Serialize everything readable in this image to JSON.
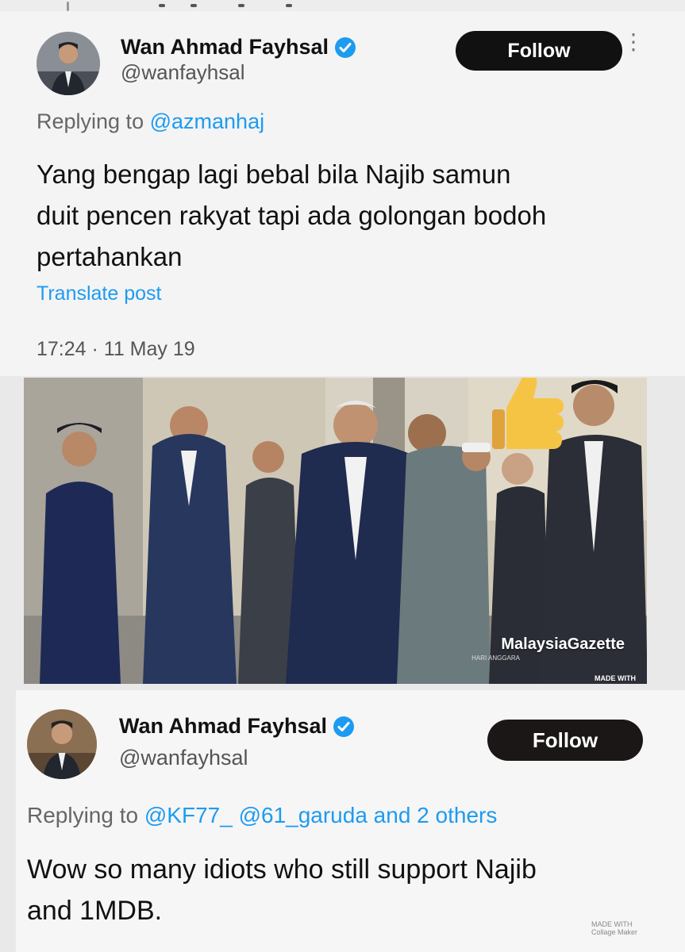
{
  "tweet1": {
    "display_name": "Wan Ahmad Fayhsal",
    "handle": "@wanfayhsal",
    "follow_label": "Follow",
    "replying_prefix": "Replying to",
    "replying_to": "@azmanhaj",
    "text_lines": [
      "Yang bengap lagi bebal bila Najib samun",
      "duit pencen rakyat tapi ada golongan bodoh",
      "pertahankan"
    ],
    "translate_label": "Translate post",
    "timestamp": "17:24 · 11 May 19"
  },
  "photo": {
    "watermark": "MalaysiaGazette",
    "watermark_credit": "HARI ANGGARA",
    "made_with": "MADE WITH",
    "emoji": "thumbs-up"
  },
  "tweet2": {
    "display_name": "Wan Ahmad Fayhsal",
    "handle": "@wanfayhsal",
    "follow_label": "Follow",
    "replying_prefix": "Replying to",
    "replying_to": "@KF77_ @61_garuda and 2 others",
    "text_lines": [
      "Wow so many idiots who still support Najib",
      "and 1MDB."
    ],
    "collage_mark_line1": "MADE WITH",
    "collage_mark_line2": "Collage Maker"
  },
  "colors": {
    "link": "#1d9bf0",
    "follow_bg": "#111111",
    "verified": "#1d9bf0"
  }
}
